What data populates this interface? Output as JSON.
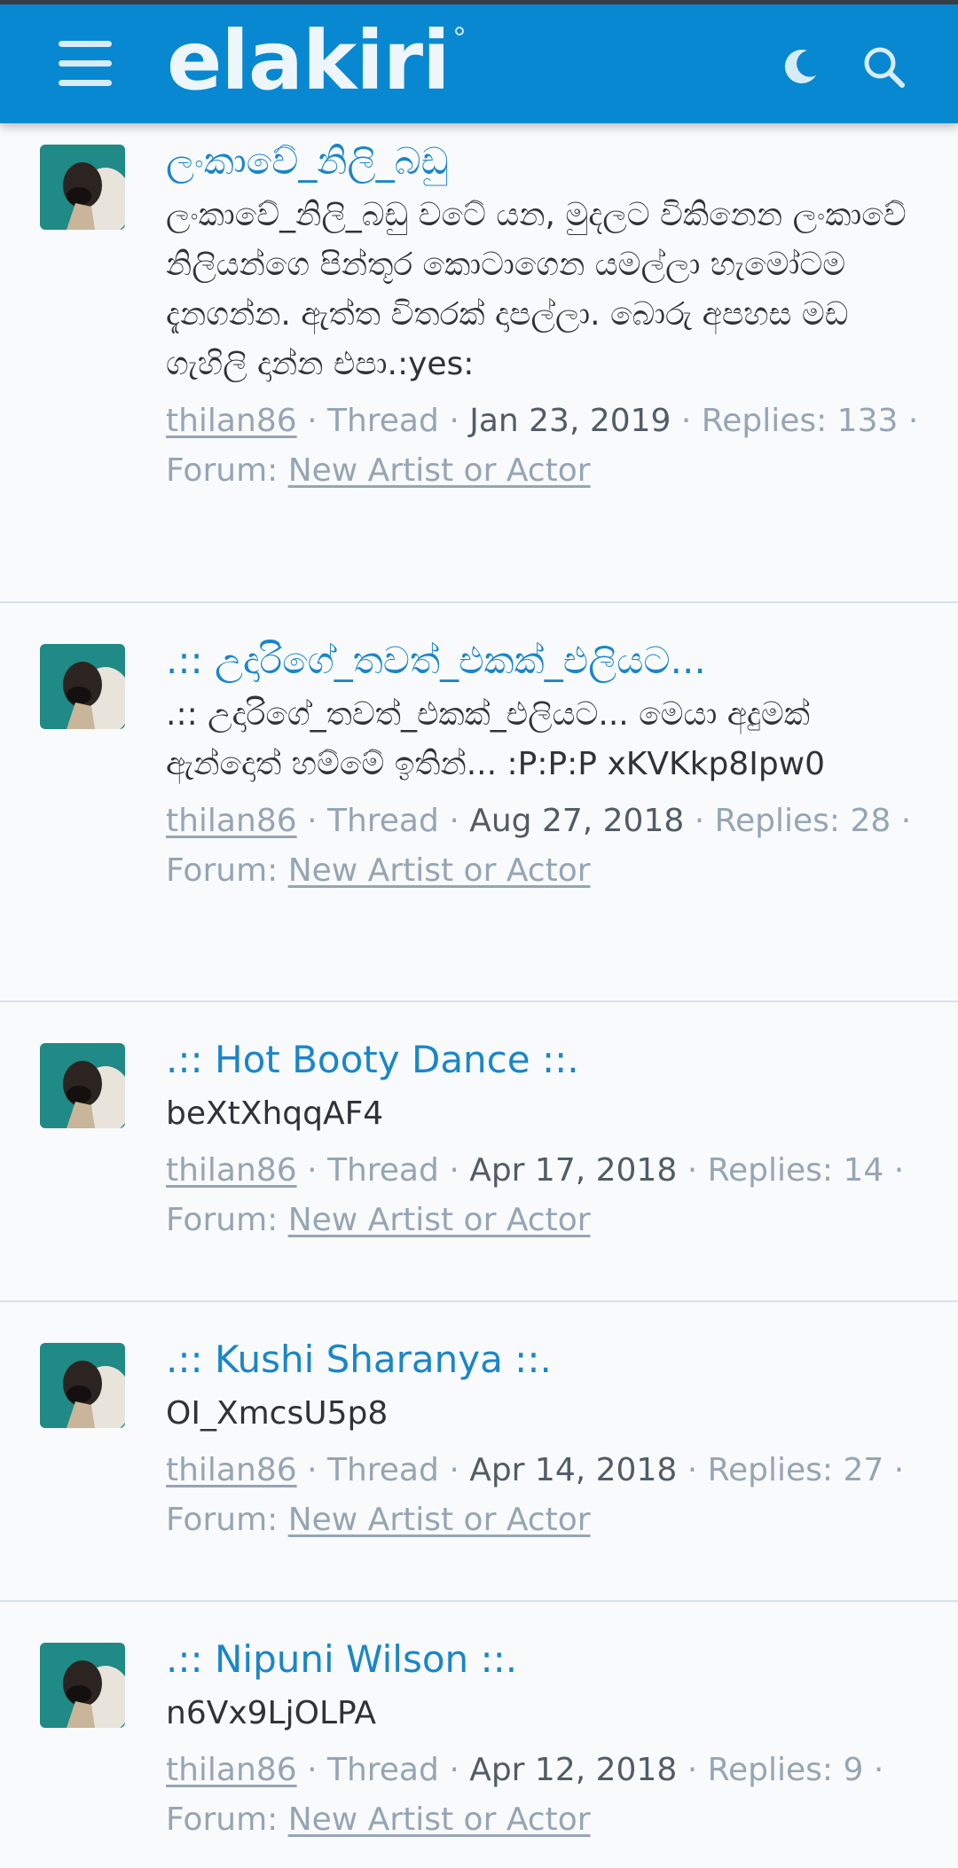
{
  "header": {
    "logo_text": "elakiri",
    "menu_icon": "hamburger-menu-icon",
    "theme_icon": "moon-icon",
    "search_icon": "search-icon",
    "bar_color": "#0788d0"
  },
  "threads": [
    {
      "title": "ලංකාවේ_නිලි_බඩු",
      "snippet": "ලංකාවේ_නිලි_බඩු වටේ යන, මුදලට විකිනෙන ලංකාවේ නිලියන්ගෙ පින්තූර කොටාගෙන යමල්ලා හැමෝටම දැනගන්න. ඇත්ත විතරක් දාපල්ලා. බොරු අපහස මඩ ගැහිලි දාන්න එපා.:yes:",
      "author": "thilan86",
      "type": "Thread",
      "date": "Jan 23, 2019",
      "replies": "Replies: 133",
      "forum_label": "Forum:",
      "forum": "New Artist or Actor"
    },
    {
      "title": ".:: උදාරිගේ_තවත්_එකක්_එලියට...",
      "snippet": ".:: උදාරිගේ_තවත්_එකක්_එලියට... මෙයා අදුමක් ඇන්දොත් හම්මේ ඉතින්... :P:P:P xKVKkp8Ipw0",
      "author": "thilan86",
      "type": "Thread",
      "date": "Aug 27, 2018",
      "replies": "Replies: 28",
      "forum_label": "Forum:",
      "forum": "New Artist or Actor"
    },
    {
      "title": ".:: Hot Booty Dance ::.",
      "snippet": "beXtXhqqAF4",
      "author": "thilan86",
      "type": "Thread",
      "date": "Apr 17, 2018",
      "replies": "Replies: 14",
      "forum_label": "Forum:",
      "forum": "New Artist or Actor"
    },
    {
      "title": ".:: Kushi Sharanya ::.",
      "snippet": "OI_XmcsU5p8",
      "author": "thilan86",
      "type": "Thread",
      "date": "Apr 14, 2018",
      "replies": "Replies: 27",
      "forum_label": "Forum:",
      "forum": "New Artist or Actor"
    },
    {
      "title": ".:: Nipuni Wilson ::.",
      "snippet": "n6Vx9LjOLPA",
      "author": "thilan86",
      "type": "Thread",
      "date": "Apr 12, 2018",
      "replies": "Replies: 9",
      "forum_label": "Forum:",
      "forum": "New Artist or Actor"
    }
  ]
}
